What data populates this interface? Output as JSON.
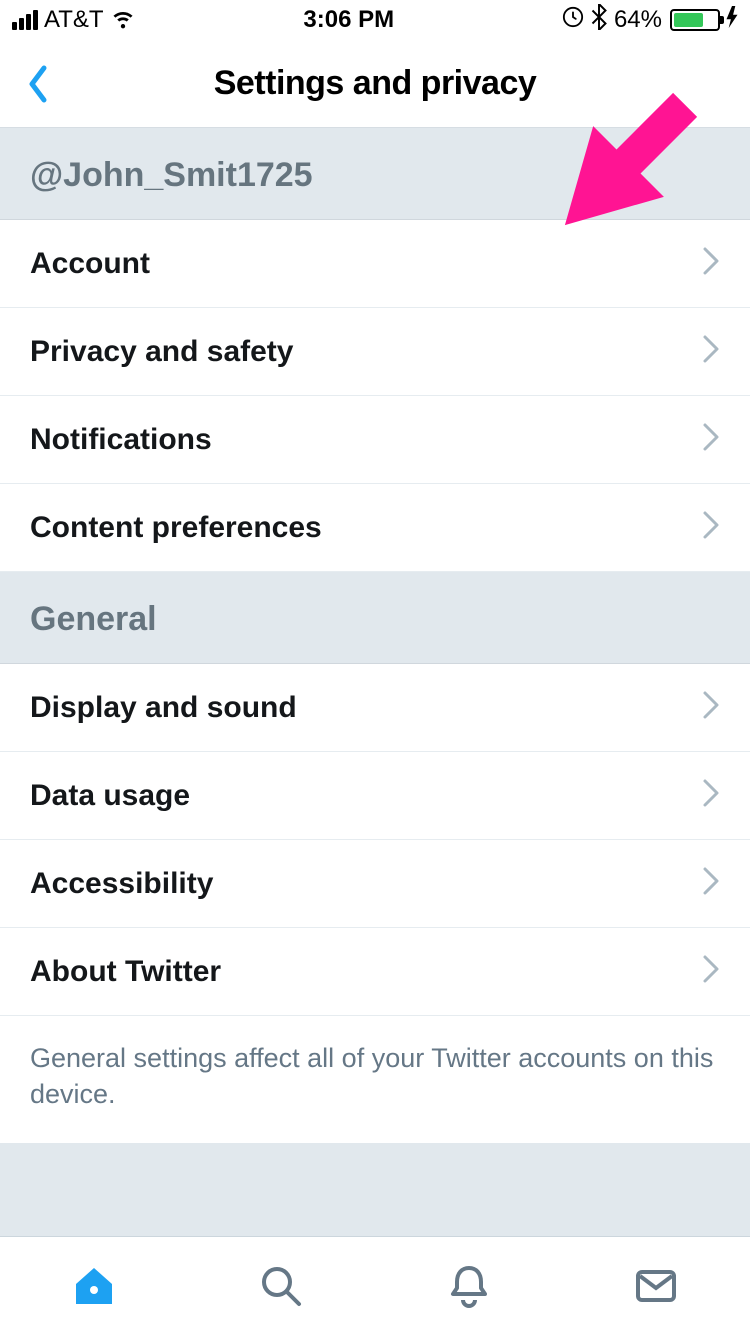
{
  "status_bar": {
    "carrier": "AT&T",
    "time": "3:06 PM",
    "battery_percent": "64%"
  },
  "header": {
    "title": "Settings and privacy"
  },
  "sections": {
    "user": {
      "handle": "@John_Smit1725",
      "items": [
        {
          "label": "Account"
        },
        {
          "label": "Privacy and safety"
        },
        {
          "label": "Notifications"
        },
        {
          "label": "Content preferences"
        }
      ]
    },
    "general": {
      "title": "General",
      "items": [
        {
          "label": "Display and sound"
        },
        {
          "label": "Data usage"
        },
        {
          "label": "Accessibility"
        },
        {
          "label": "About Twitter"
        }
      ],
      "footer": "General settings affect all of your Twitter accounts on this device."
    }
  },
  "colors": {
    "accent": "#1da1f2",
    "section_bg": "#e1e8ed",
    "muted_text": "#657786",
    "annotation": "#ff1493"
  }
}
